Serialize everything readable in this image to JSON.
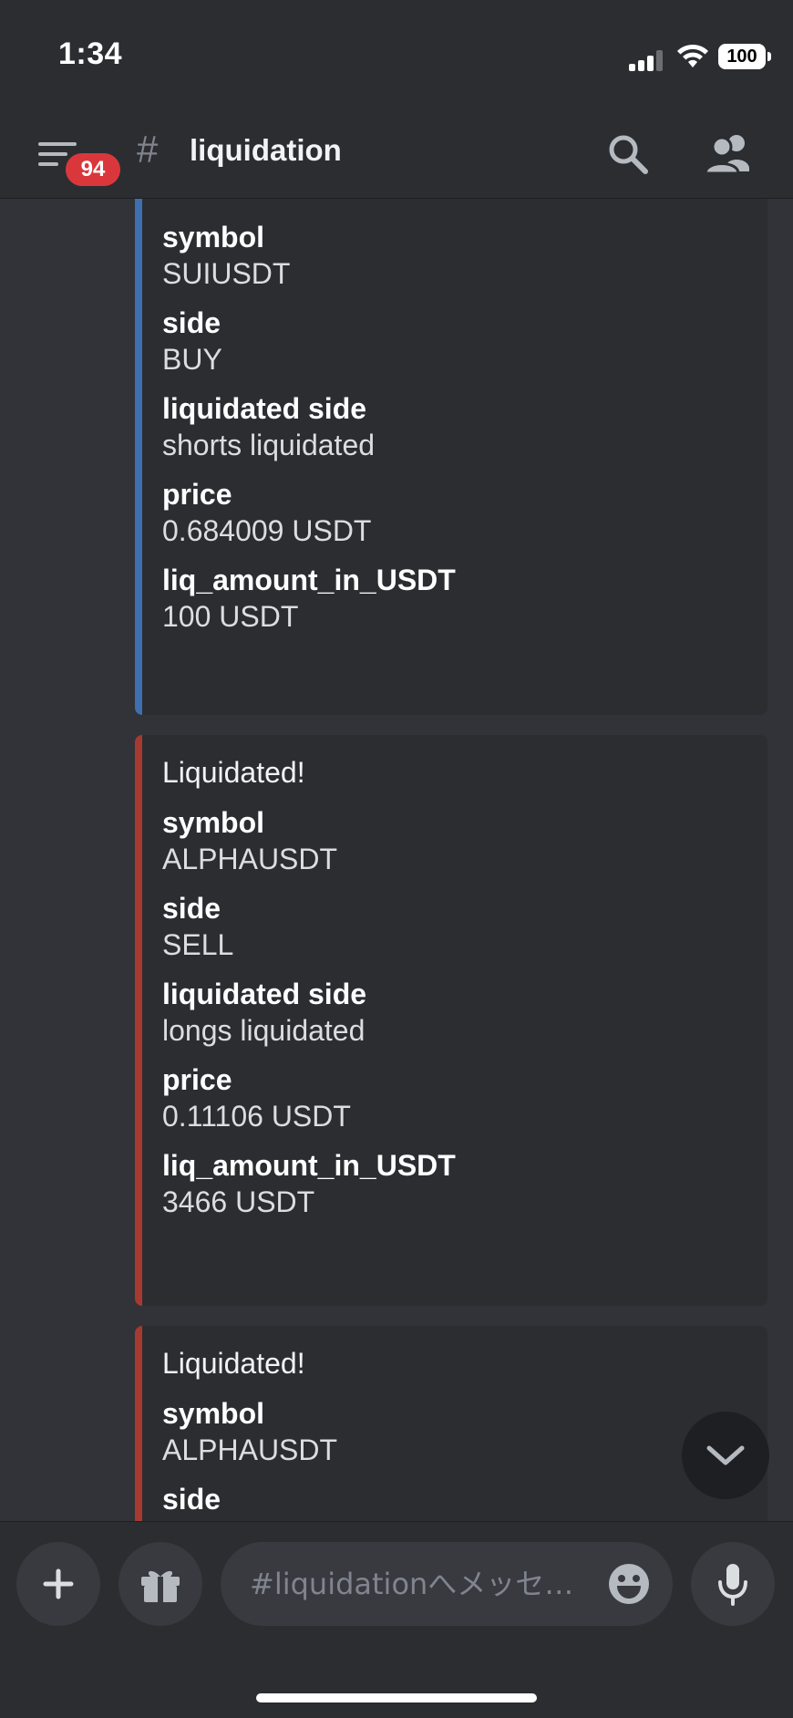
{
  "status_bar": {
    "time": "1:34",
    "battery": "100"
  },
  "header": {
    "unread_badge": "94",
    "channel_hash": "#",
    "channel_name": "liquidation"
  },
  "embeds": [
    {
      "color": "#3e70b0",
      "title": "",
      "fields": [
        {
          "name": "symbol",
          "value": "SUIUSDT"
        },
        {
          "name": "side",
          "value": "BUY"
        },
        {
          "name": "liquidated side",
          "value": "shorts liquidated"
        },
        {
          "name": "price",
          "value": "0.684009 USDT"
        },
        {
          "name": "liq_amount_in_USDT",
          "value": "100 USDT"
        }
      ]
    },
    {
      "color": "#a63a30",
      "title": "Liquidated!",
      "fields": [
        {
          "name": "symbol",
          "value": "ALPHAUSDT"
        },
        {
          "name": "side",
          "value": "SELL"
        },
        {
          "name": "liquidated side",
          "value": "longs liquidated"
        },
        {
          "name": "price",
          "value": "0.11106 USDT"
        },
        {
          "name": "liq_amount_in_USDT",
          "value": "3466 USDT"
        }
      ]
    },
    {
      "color": "#a63a30",
      "title": "Liquidated!",
      "fields": [
        {
          "name": "symbol",
          "value": "ALPHAUSDT"
        },
        {
          "name": "side",
          "value": ""
        }
      ]
    }
  ],
  "composer": {
    "placeholder": "#liquidationへメッセ…"
  },
  "icons": {
    "menu": "hamburger-menu-icon",
    "search": "search-icon",
    "members": "members-icon",
    "scroll": "chevron-down-icon",
    "add": "plus-icon",
    "gift": "gift-icon",
    "emoji": "emoji-icon",
    "mic": "microphone-icon"
  }
}
